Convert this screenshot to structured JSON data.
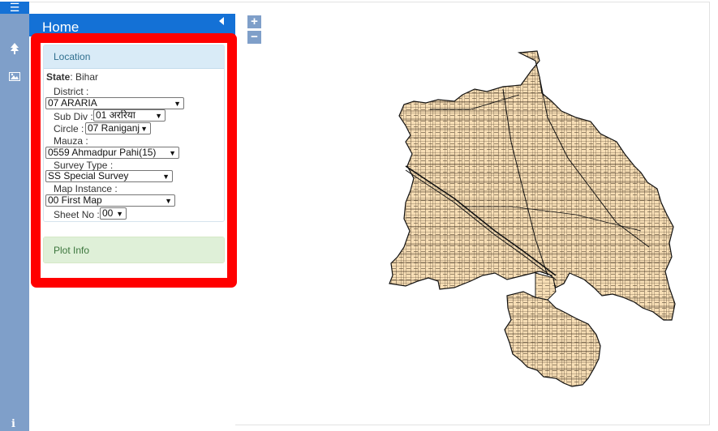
{
  "header": {
    "title": "Home"
  },
  "rail": {
    "menu_icon": "hamburger-menu-icon",
    "tree_icon": "tree-icon",
    "image_icon": "image-icon",
    "info_icon": "info-icon",
    "info_glyph": "i"
  },
  "location": {
    "title": "Location",
    "state_label": "State",
    "state_value": ": Bihar",
    "district_label": "District :",
    "district_value": "07 ARARIA",
    "subdiv_label": "Sub Div :",
    "subdiv_value": "01 अररिया",
    "circle_label": "Circle :",
    "circle_value": "07 Raniganj",
    "mauza_label": "Mauza :",
    "mauza_value": "0559 Ahmadpur Pahi(15)",
    "survey_label": "Survey Type :",
    "survey_value": "SS Special Survey",
    "instance_label": "Map Instance :",
    "instance_value": "00 First Map",
    "sheet_label": "Sheet No :",
    "sheet_value": "00"
  },
  "plot_info": {
    "title": "Plot Info"
  },
  "zoom": {
    "in": "+",
    "out": "−"
  },
  "colors": {
    "header_blue": "#1471d6",
    "rail_blue": "#7f9fc9",
    "highlight_red": "#ff0000",
    "parcel_fill": "#f7deb5"
  }
}
